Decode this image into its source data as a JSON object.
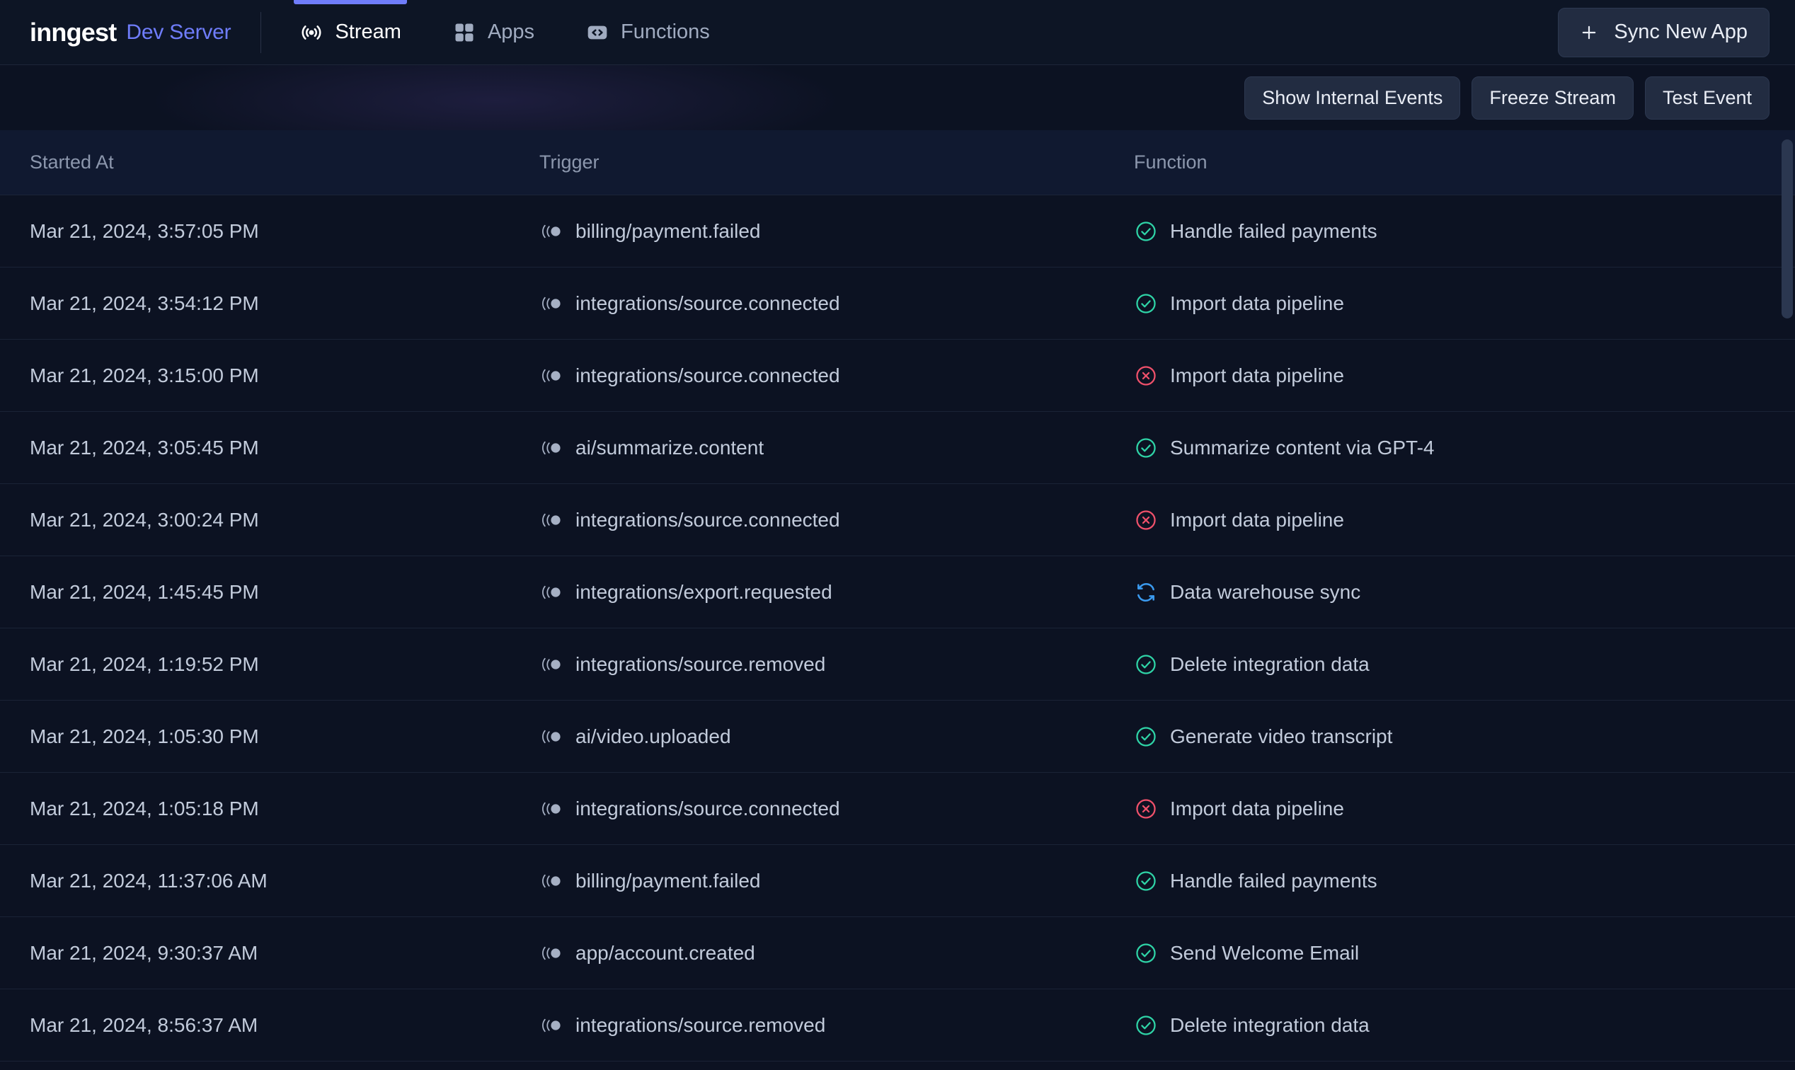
{
  "brand": {
    "name": "inngest",
    "subtitle": "Dev Server"
  },
  "nav": {
    "tabs": [
      {
        "label": "Stream",
        "icon": "broadcast-icon",
        "active": true
      },
      {
        "label": "Apps",
        "icon": "grid-icon",
        "active": false
      },
      {
        "label": "Functions",
        "icon": "code-brackets-icon",
        "active": false
      }
    ],
    "sync_button": {
      "label": "Sync New App",
      "icon": "plus-icon"
    }
  },
  "toolbar": {
    "buttons": [
      {
        "label": "Show Internal Events",
        "name": "show-internal-events-button"
      },
      {
        "label": "Freeze Stream",
        "name": "freeze-stream-button"
      },
      {
        "label": "Test Event",
        "name": "test-event-button"
      }
    ]
  },
  "table": {
    "columns": [
      "Started At",
      "Trigger",
      "Function"
    ],
    "rows": [
      {
        "started_at": "Mar 21, 2024, 3:57:05 PM",
        "trigger": "billing/payment.failed",
        "function": "Handle failed payments",
        "status": "completed"
      },
      {
        "started_at": "Mar 21, 2024, 3:54:12 PM",
        "trigger": "integrations/source.connected",
        "function": "Import data pipeline",
        "status": "completed"
      },
      {
        "started_at": "Mar 21, 2024, 3:15:00 PM",
        "trigger": "integrations/source.connected",
        "function": "Import data pipeline",
        "status": "failed"
      },
      {
        "started_at": "Mar 21, 2024, 3:05:45 PM",
        "trigger": "ai/summarize.content",
        "function": "Summarize content via GPT-4",
        "status": "completed"
      },
      {
        "started_at": "Mar 21, 2024, 3:00:24 PM",
        "trigger": "integrations/source.connected",
        "function": "Import data pipeline",
        "status": "failed"
      },
      {
        "started_at": "Mar 21, 2024, 1:45:45 PM",
        "trigger": "integrations/export.requested",
        "function": "Data warehouse sync",
        "status": "running"
      },
      {
        "started_at": "Mar 21, 2024, 1:19:52 PM",
        "trigger": "integrations/source.removed",
        "function": "Delete integration data",
        "status": "completed"
      },
      {
        "started_at": "Mar 21, 2024, 1:05:30 PM",
        "trigger": "ai/video.uploaded",
        "function": "Generate video transcript",
        "status": "completed"
      },
      {
        "started_at": "Mar 21, 2024, 1:05:18 PM",
        "trigger": "integrations/source.connected",
        "function": "Import data pipeline",
        "status": "failed"
      },
      {
        "started_at": "Mar 21, 2024, 11:37:06 AM",
        "trigger": "billing/payment.failed",
        "function": "Handle failed payments",
        "status": "completed"
      },
      {
        "started_at": "Mar 21, 2024, 9:30:37 AM",
        "trigger": "app/account.created",
        "function": "Send Welcome Email",
        "status": "completed"
      },
      {
        "started_at": "Mar 21, 2024, 8:56:37 AM",
        "trigger": "integrations/source.removed",
        "function": "Delete integration data",
        "status": "completed"
      }
    ]
  },
  "icons": {
    "trigger": "event-pulse-icon",
    "status_completed": "check-circle-icon",
    "status_failed": "x-circle-icon",
    "status_running": "refresh-circular-arrows-icon"
  },
  "colors": {
    "background": "#0c1222",
    "header_background": "#0d1525",
    "accent": "#6f7dfb",
    "status_completed": "#2fd4a7",
    "status_failed": "#f0516b",
    "status_running": "#3b9bf0",
    "text_primary": "#c2cbdb",
    "text_muted": "#8c97ad",
    "row_border": "#1a2336"
  },
  "scrollbar": {
    "position": "right",
    "thumb_top_percent": 1,
    "thumb_height_percent": 19
  }
}
